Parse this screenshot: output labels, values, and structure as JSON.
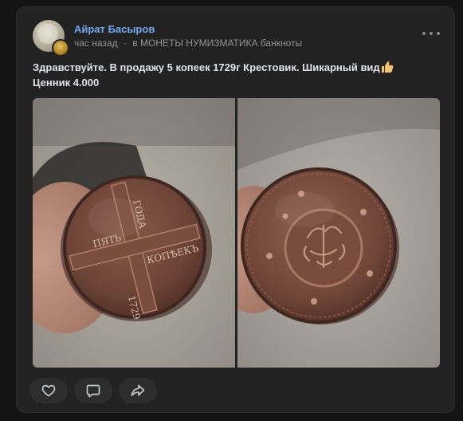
{
  "post": {
    "author": "Айрат Басыров",
    "time": "час назад",
    "separator": "·",
    "group_prefix": "в",
    "group_name": "МОНЕТЫ НУМИЗМАТИКА банкноты",
    "text_line1": "Здравствуйте. В продажу 5 копеек 1729г Крестовик. Шикарный вид",
    "text_line2": "Ценник 4.000",
    "emoji_icon": "thumbs-up-icon"
  },
  "colors": {
    "link": "#71aaeb",
    "card_bg": "#222222",
    "page_bg": "#141414",
    "muted": "#939393"
  },
  "coin_photos": [
    {
      "side": "obverse",
      "inscription": "ПЯТЬ КОПѢЕКЪ 1729 ГОДА"
    },
    {
      "side": "reverse"
    }
  ],
  "coin_text": {
    "top": "ПЯТЬ",
    "mid": "КОПѢЕКЪ",
    "year": "1729",
    "god": "ГОДА"
  },
  "actions": [
    {
      "name": "like",
      "icon": "heart-icon"
    },
    {
      "name": "comment",
      "icon": "comment-icon"
    },
    {
      "name": "share",
      "icon": "share-icon"
    }
  ],
  "menu_icon": "more-dots-icon"
}
